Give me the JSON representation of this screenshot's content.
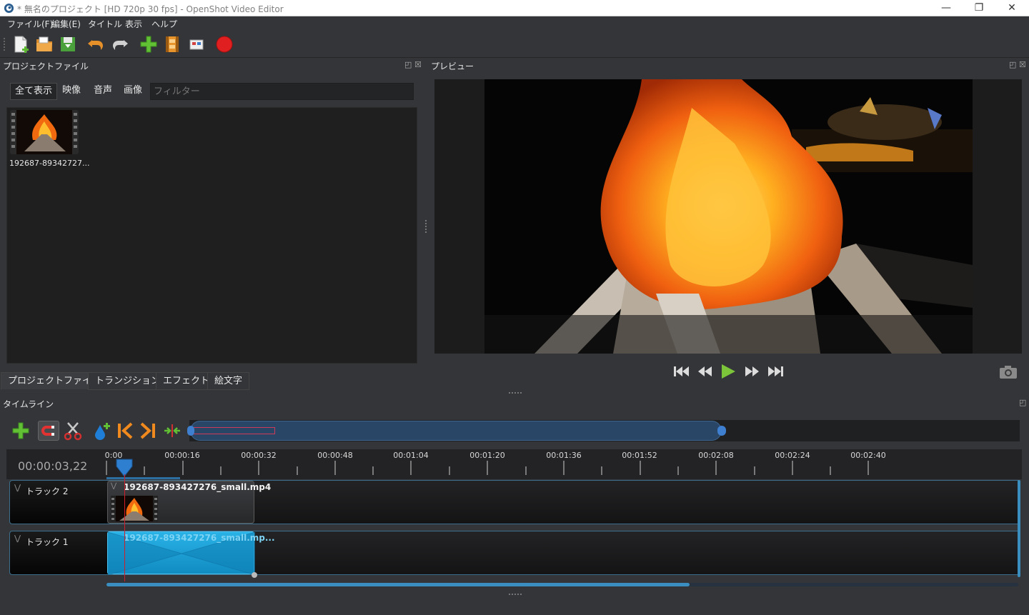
{
  "window": {
    "title": "* 無名のプロジェクト [HD 720p 30 fps] - OpenShot Video Editor",
    "minimize": "—",
    "restore": "❐",
    "close": "✕"
  },
  "menu": [
    "ファイル(F)",
    "編集(E)",
    "タイトル",
    "表示",
    "ヘルプ"
  ],
  "toolbar": {
    "icons": [
      "new-project-icon",
      "open-project-icon",
      "save-project-icon",
      "undo-icon",
      "redo-icon",
      "import-files-icon",
      "choose-profile-icon",
      "fullscreen-icon",
      "export-video-icon"
    ]
  },
  "project_files": {
    "title": "プロジェクトファイル",
    "filters": [
      "全て表示",
      "映像",
      "音声",
      "画像"
    ],
    "search_placeholder": "フィルター",
    "items": [
      {
        "name": "192687-89342727..."
      }
    ]
  },
  "bottom_tabs": [
    "プロジェクトファイル",
    "トランジション",
    "エフェクト",
    "絵文字"
  ],
  "preview": {
    "title": "プレビュー"
  },
  "timeline": {
    "title": "タイムライン",
    "current_time": "00:00:03,22",
    "ruler_labels": [
      "0:00",
      "00:00:16",
      "00:00:32",
      "00:00:48",
      "00:01:04",
      "00:01:20",
      "00:01:36",
      "00:01:52",
      "00:02:08",
      "00:02:24",
      "00:02:40"
    ],
    "tracks": [
      {
        "name": "トラック 2",
        "clip": "192687-893427276_small.mp4"
      },
      {
        "name": "トラック 1",
        "clip": "192687-893427276_small.mp..."
      }
    ]
  },
  "colors": {
    "background": "#333538",
    "accent_blue": "#1a9fd0",
    "playhead": "#d01f2a",
    "record_red": "#e02020",
    "play_green": "#7cc43a"
  }
}
